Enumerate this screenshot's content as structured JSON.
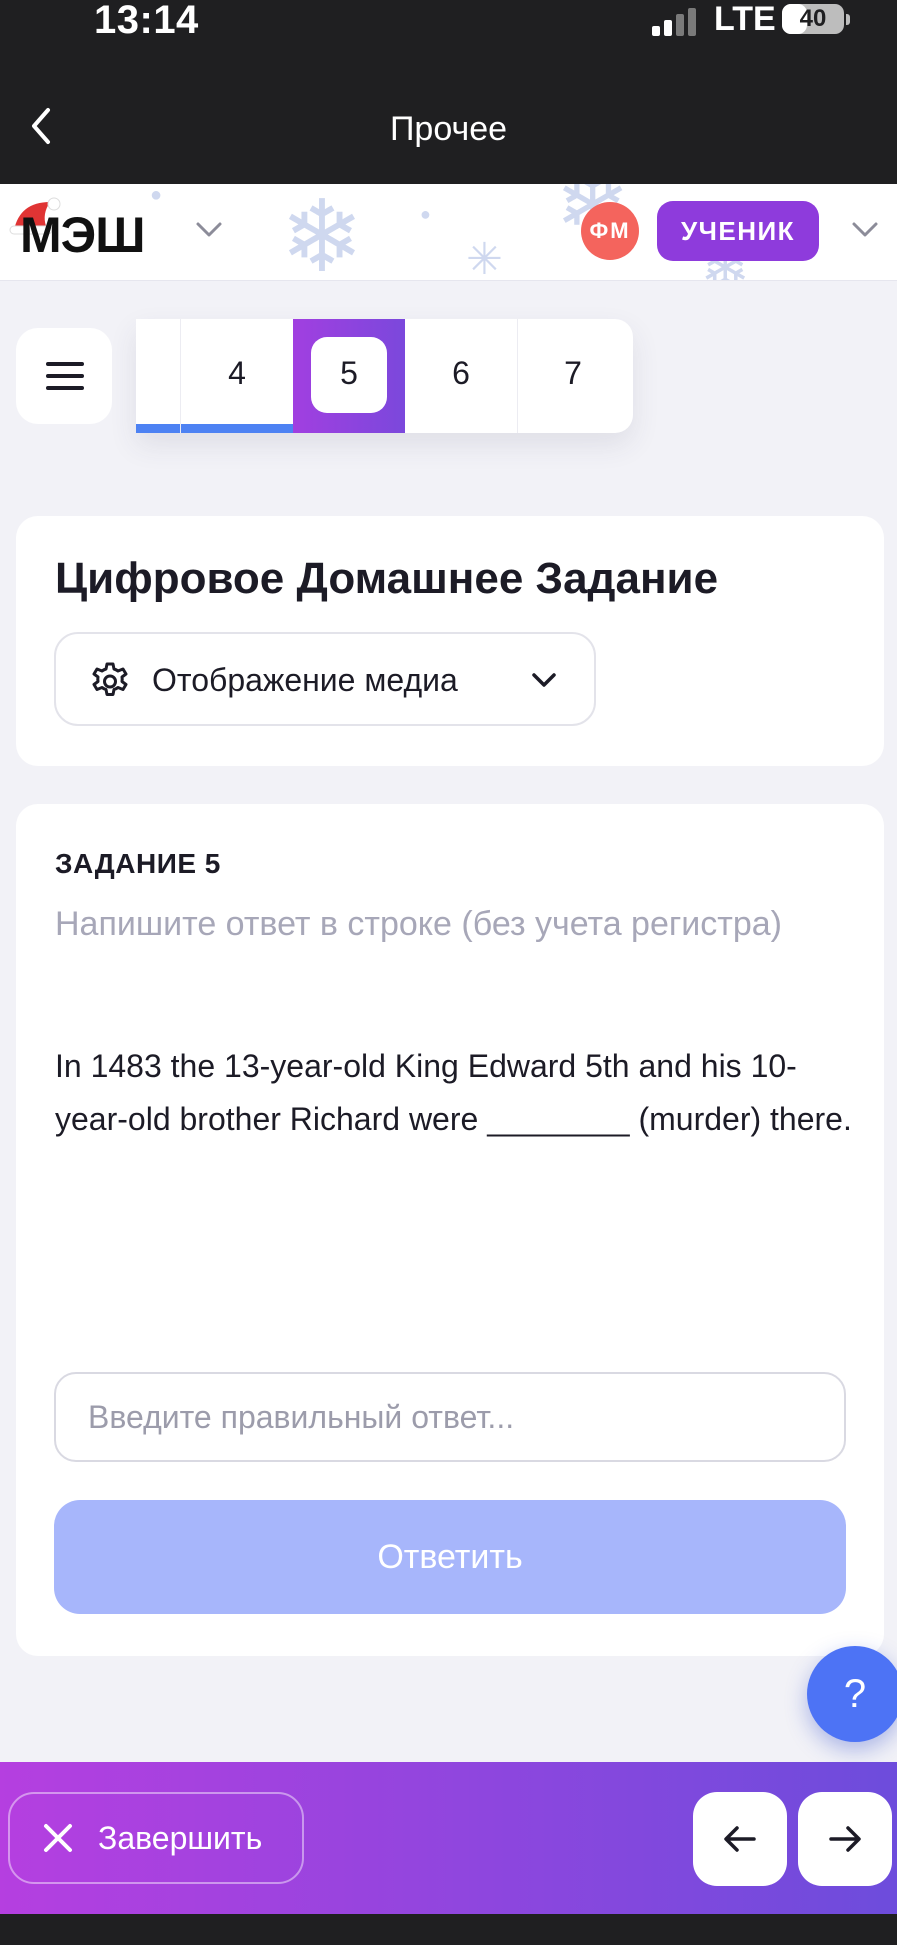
{
  "status_bar": {
    "time": "13:14",
    "network": "LTE",
    "battery": "40",
    "battery_level_percent": 40
  },
  "nav": {
    "title": "Прочее",
    "back_icon": "chevron-left-icon"
  },
  "brand": {
    "logo": "МЭШ",
    "avatar_initials": "ФМ",
    "role_label": "УЧЕНИК"
  },
  "task_tabs": [
    {
      "label": "",
      "completed": true
    },
    {
      "label": "4",
      "completed": true
    },
    {
      "label": "5",
      "active": true
    },
    {
      "label": "6"
    },
    {
      "label": "7"
    }
  ],
  "header_card": {
    "title": "Цифровое Домашнее Задание",
    "media_button_label": "Отображение медиа",
    "media_icon": "gear-icon"
  },
  "task": {
    "label": "ЗАДАНИЕ 5",
    "hint": "Напишите ответ в строке (без учета регистра)",
    "question": "In 1483 the 13-year-old King Edward 5th and his 10-year-old brother Richard were  ________ (murder) there.",
    "input_placeholder": "Введите правильный ответ...",
    "submit_label": "Ответить"
  },
  "help_button": {
    "label": "?"
  },
  "footer": {
    "finish_label": "Завершить",
    "prev_icon": "arrow-left-icon",
    "next_icon": "arrow-right-icon"
  },
  "colors": {
    "accent_purple": "#8e3bdc",
    "progress_blue": "#4d82f3",
    "submit_disabled": "#a7b6fb",
    "help_blue": "#4d73f5",
    "avatar_red": "#f4645d"
  }
}
